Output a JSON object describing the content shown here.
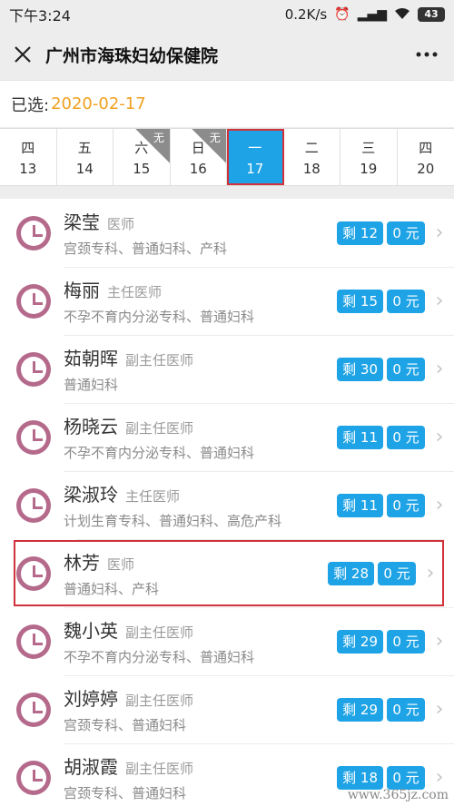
{
  "status_bar": {
    "time": "下午3:24",
    "speed": "0.2K/s",
    "battery": "43"
  },
  "header": {
    "title": "广州市海珠妇幼保健院"
  },
  "selected": {
    "label": "已选:",
    "date": "2020-02-17"
  },
  "dates": [
    {
      "week": "四",
      "day": "13",
      "badge": ""
    },
    {
      "week": "五",
      "day": "14",
      "badge": ""
    },
    {
      "week": "六",
      "day": "15",
      "badge": "无"
    },
    {
      "week": "日",
      "day": "16",
      "badge": "无"
    },
    {
      "week": "一",
      "day": "17",
      "badge": ""
    },
    {
      "week": "二",
      "day": "18",
      "badge": ""
    },
    {
      "week": "三",
      "day": "19",
      "badge": ""
    },
    {
      "week": "四",
      "day": "20",
      "badge": ""
    }
  ],
  "active_date_index": 4,
  "doctors": [
    {
      "name": "梁莹",
      "title": "医师",
      "specialty": "宫颈专科、普通妇科、产科",
      "remaining": "剩 12",
      "fee": "0 元"
    },
    {
      "name": "梅丽",
      "title": "主任医师",
      "specialty": "不孕不育内分泌专科、普通妇科",
      "remaining": "剩 15",
      "fee": "0 元"
    },
    {
      "name": "茹朝晖",
      "title": "副主任医师",
      "specialty": "普通妇科",
      "remaining": "剩 30",
      "fee": "0 元"
    },
    {
      "name": "杨晓云",
      "title": "副主任医师",
      "specialty": "不孕不育内分泌专科、普通妇科",
      "remaining": "剩 11",
      "fee": "0 元"
    },
    {
      "name": "梁淑玲",
      "title": "主任医师",
      "specialty": "计划生育专科、普通妇科、高危产科",
      "remaining": "剩 11",
      "fee": "0 元"
    },
    {
      "name": "林芳",
      "title": "医师",
      "specialty": "普通妇科、产科",
      "remaining": "剩 28",
      "fee": "0 元"
    },
    {
      "name": "魏小英",
      "title": "副主任医师",
      "specialty": "不孕不育内分泌专科、普通妇科",
      "remaining": "剩 29",
      "fee": "0 元"
    },
    {
      "name": "刘婷婷",
      "title": "副主任医师",
      "specialty": "宫颈专科、普通妇科",
      "remaining": "剩 29",
      "fee": "0 元"
    },
    {
      "name": "胡淑霞",
      "title": "副主任医师",
      "specialty": "宫颈专科、普通妇科",
      "remaining": "剩 18",
      "fee": "0 元"
    }
  ],
  "highlighted_doctor_index": 5,
  "watermark": "www.365jz.com",
  "colors": {
    "accent": "#1ea3e6",
    "selected_date": "#f0a020",
    "highlight_border": "#d0313a",
    "clock": "#b56a8b"
  }
}
